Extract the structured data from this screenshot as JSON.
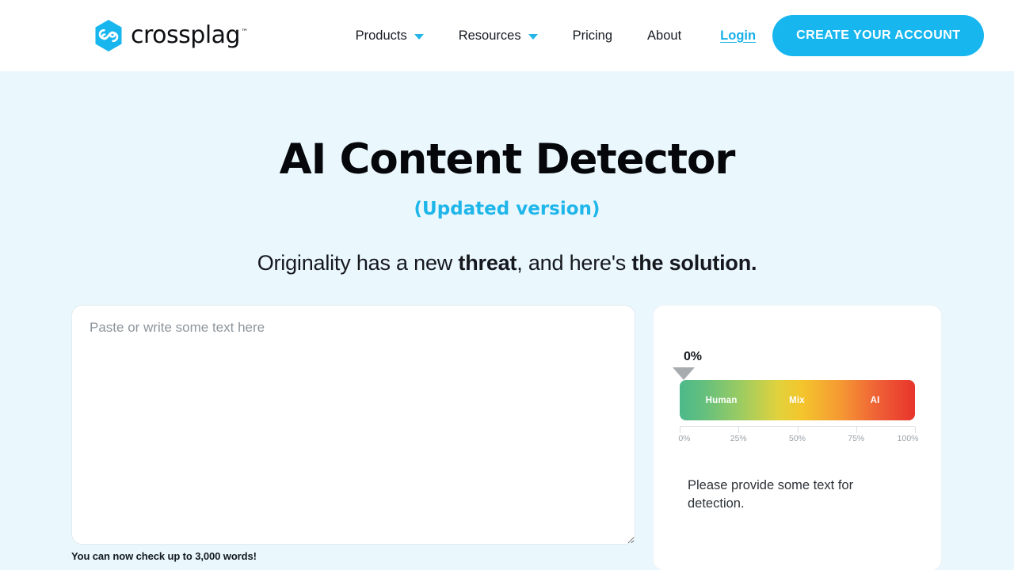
{
  "header": {
    "brand": {
      "name": "crossplag",
      "trademark": "™",
      "logo_icon": "crossplag-hexagon-logo",
      "logo_color": "#18b6ef"
    },
    "nav": [
      {
        "label": "Products",
        "has_dropdown": true,
        "icon": "chevron-down-icon"
      },
      {
        "label": "Resources",
        "has_dropdown": true,
        "icon": "chevron-down-icon"
      },
      {
        "label": "Pricing",
        "has_dropdown": false
      },
      {
        "label": "About",
        "has_dropdown": false
      }
    ],
    "login_label": "Login",
    "cta_label": "CREATE YOUR ACCOUNT",
    "accent_color": "#18b6ef"
  },
  "hero": {
    "title": "AI Content Detector",
    "subtitle": "(Updated version)",
    "tagline": {
      "part1": "Originality has a new ",
      "bold1": "threat",
      "part2": ", and here's ",
      "bold2": "the solution."
    }
  },
  "editor": {
    "placeholder": "Paste or write some text here",
    "value": "",
    "word_hint": "You can now check up to 3,000 words!"
  },
  "result": {
    "score_label": "0%",
    "message": "Please provide some text for detection.",
    "zones": [
      {
        "label": "Human"
      },
      {
        "label": "Mix"
      },
      {
        "label": "AI"
      }
    ],
    "axis_labels": [
      "0%",
      "25%",
      "50%",
      "75%",
      "100%"
    ]
  },
  "chart_data": {
    "type": "bar",
    "title": "AI Content Detection Score",
    "categories": [
      "Human",
      "Mix",
      "AI"
    ],
    "values": [
      0
    ],
    "score": 0,
    "unit": "%",
    "xlabel": "",
    "ylabel": "",
    "xlim": [
      0,
      100
    ],
    "tick_labels": [
      "0%",
      "25%",
      "50%",
      "75%",
      "100%"
    ],
    "ticks": [
      0,
      25,
      50,
      75,
      100
    ],
    "pointer_position": 0,
    "gradient_stops": [
      "#4cb98a",
      "#9ccc62",
      "#e2d23c",
      "#f59a33",
      "#e8342c"
    ],
    "grid": false,
    "legend": "none"
  },
  "background_color": "#eaf7fd"
}
